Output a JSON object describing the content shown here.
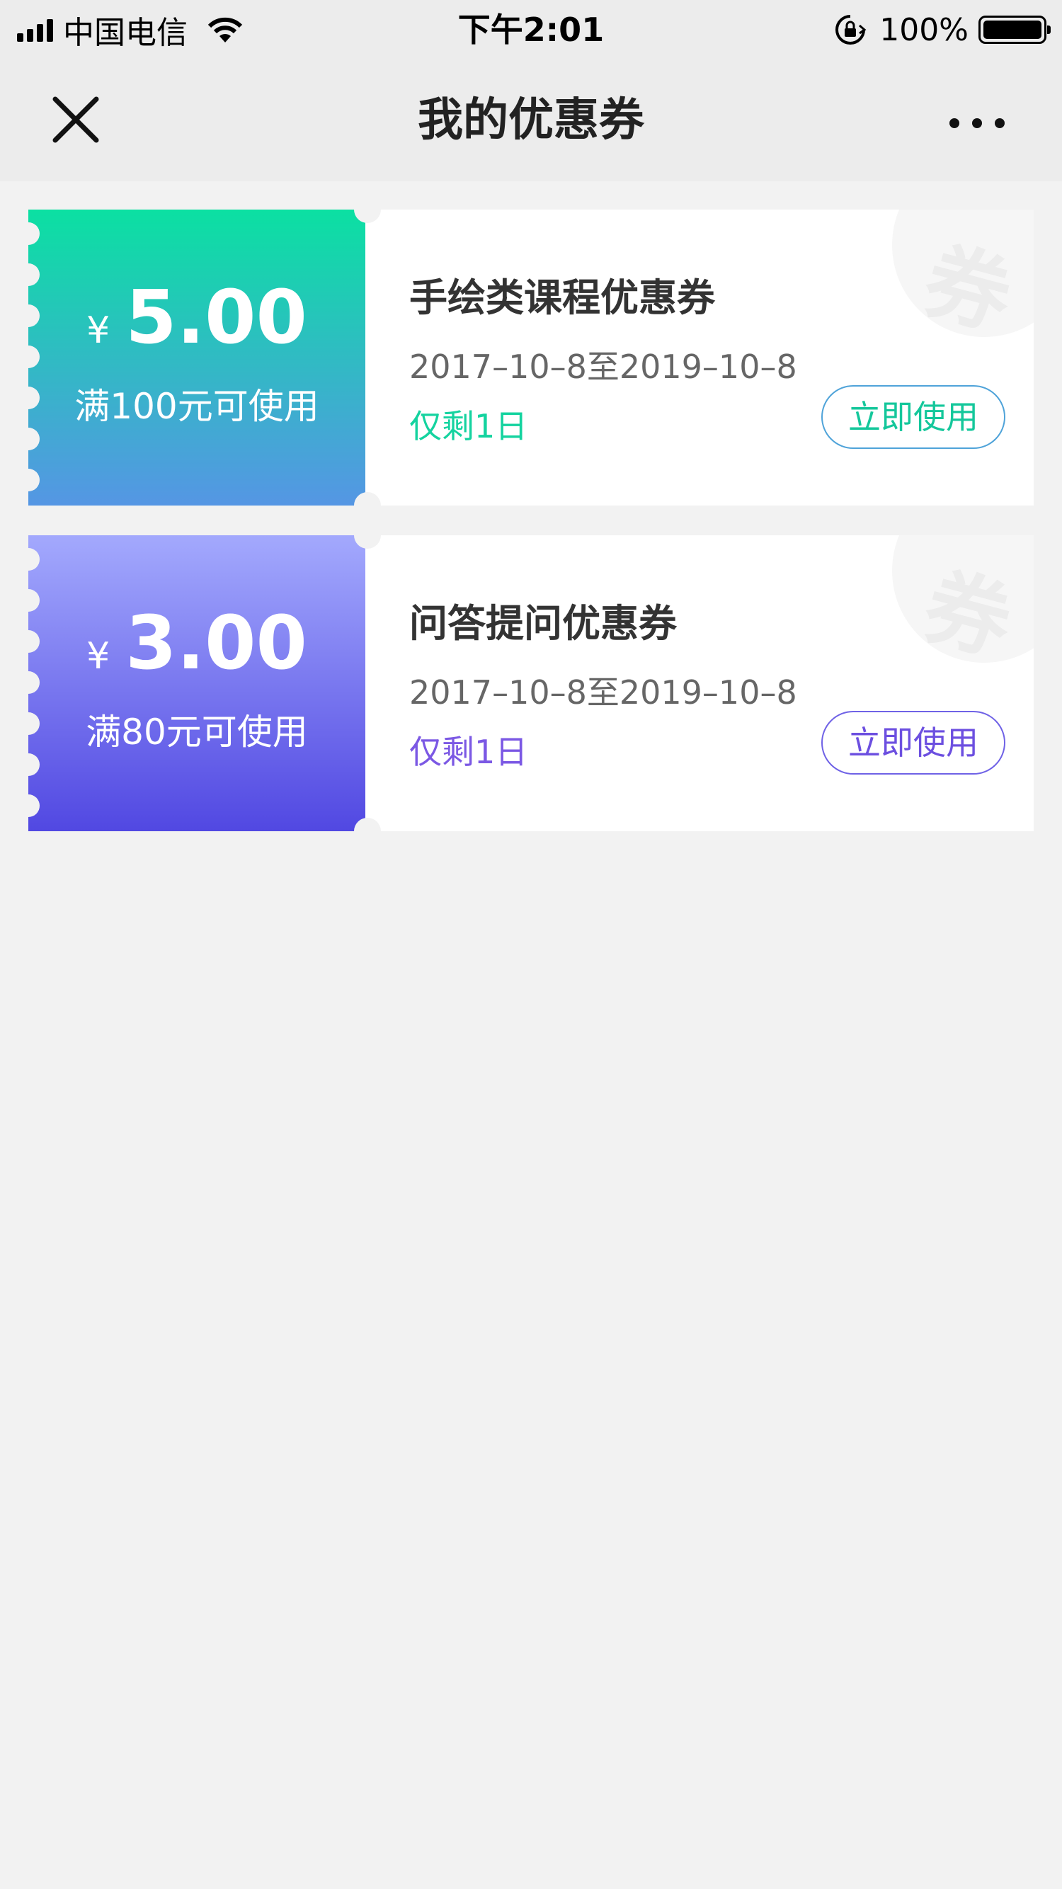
{
  "status_bar": {
    "carrier": "中国电信",
    "time": "下午2:01",
    "battery": "100%"
  },
  "nav": {
    "title": "我的优惠券"
  },
  "coupons": [
    {
      "theme": "green",
      "currency": "¥",
      "amount": "5.00",
      "condition": "满100元可使用",
      "title": "手绘类课程优惠券",
      "dates": "2017–10–8至2019–10–8",
      "remaining": "仅剩1日",
      "button": "立即使用",
      "watermark": "券",
      "colors": {
        "gradient_top": "#0be0a2",
        "gradient_bottom": "#5596e4",
        "accent": "#14d39f"
      }
    },
    {
      "theme": "purple",
      "currency": "¥",
      "amount": "3.00",
      "condition": "满80元可使用",
      "title": "问答提问优惠券",
      "dates": "2017–10–8至2019–10–8",
      "remaining": "仅剩1日",
      "button": "立即使用",
      "watermark": "券",
      "colors": {
        "gradient_top": "#a3a9fd",
        "gradient_bottom": "#5148e2",
        "accent": "#7b58e4"
      }
    }
  ],
  "icons": {
    "signal": "signal-icon",
    "wifi": "wifi-icon",
    "rotation_lock": "rotation-lock-icon",
    "battery": "battery-icon",
    "close": "close-icon",
    "more": "more-icon"
  }
}
